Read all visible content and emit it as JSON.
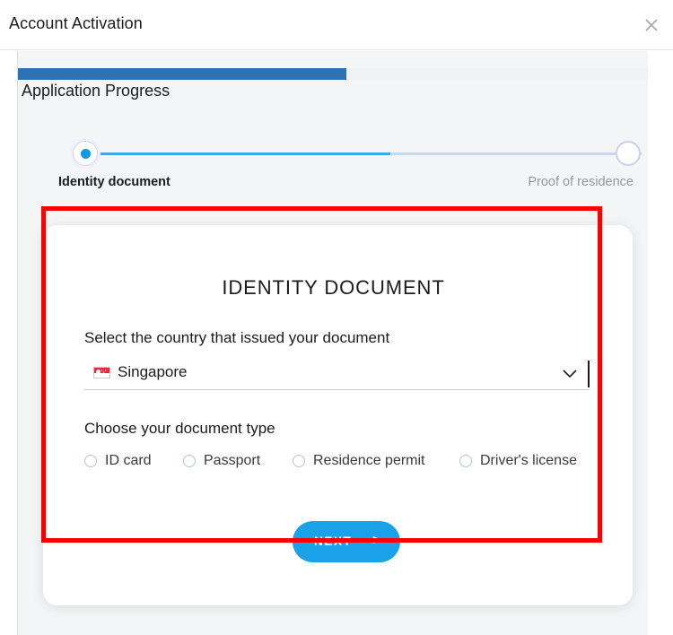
{
  "window": {
    "title": "Account Activation",
    "close_icon": "close-icon"
  },
  "progress": {
    "heading": "Application Progress",
    "percent": 52,
    "fill_color": "#2d72b3",
    "track_color": "#f1f2f3"
  },
  "stepper": {
    "steps": [
      {
        "label": "Identity document",
        "state": "active"
      },
      {
        "label": "Proof of residence",
        "state": "pending"
      }
    ],
    "active_color": "#0d9ae5",
    "line_done_color": "#3fa9e8",
    "line_todo_color": "#cfd6ef"
  },
  "form": {
    "title": "IDENTITY DOCUMENT",
    "country": {
      "label": "Select the country that issued your document",
      "selected": "Singapore",
      "flag_icon": "singapore-flag-icon",
      "chevron_icon": "chevron-down-icon"
    },
    "document_type": {
      "label": "Choose your document type",
      "options": [
        {
          "label": "ID card",
          "selected": false
        },
        {
          "label": "Passport",
          "selected": false
        },
        {
          "label": "Residence permit",
          "selected": false
        },
        {
          "label": "Driver's license",
          "selected": false
        }
      ]
    },
    "submit": {
      "label": "NEXT",
      "arrow": ">",
      "color": "#1ba1e8"
    }
  },
  "annotation": {
    "box_color": "#fb0000"
  }
}
